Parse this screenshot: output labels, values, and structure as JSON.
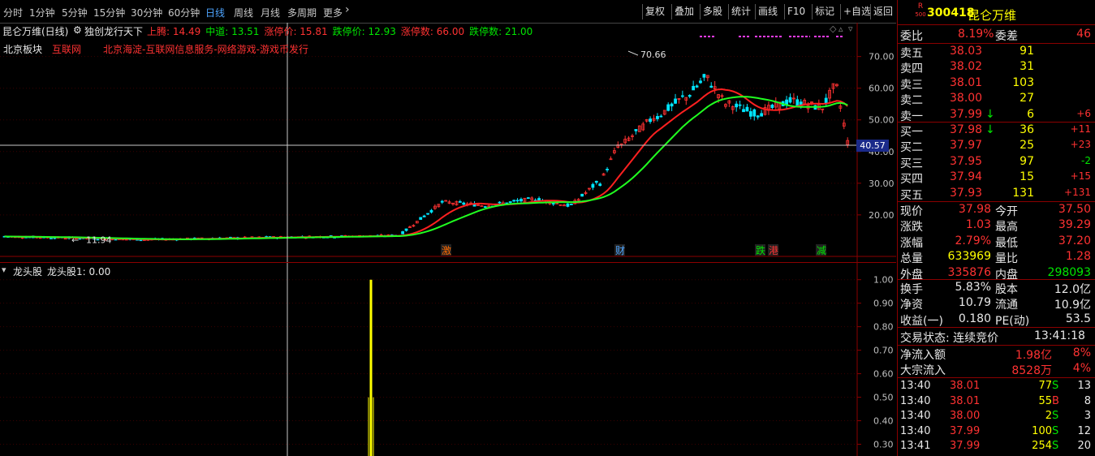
{
  "toolbar": {
    "periods": [
      "分时",
      "1分钟",
      "5分钟",
      "15分钟",
      "30分钟",
      "60分钟",
      "日线",
      "周线",
      "月线",
      "多周期",
      "更多"
    ],
    "active": "日线",
    "more_arrow": "›",
    "right_buttons": [
      "复权",
      "叠加",
      "多股",
      "统计",
      "画线",
      "F10",
      "标记",
      "+自选",
      "返回"
    ]
  },
  "main": {
    "stock_period": "昆仑万维(日线)",
    "indicator_name": "独创龙行天下",
    "lines": [
      {
        "label": "上腾: 14.49",
        "color": "#ff3232"
      },
      {
        "label": "中道: 13.51",
        "color": "#00e600"
      },
      {
        "label": "涨停价: 15.81",
        "color": "#ff3232"
      },
      {
        "label": "跌停价: 12.93",
        "color": "#00e600"
      },
      {
        "label": "涨停数: 66.00",
        "color": "#ff3232"
      },
      {
        "label": "跌停数: 21.00",
        "color": "#00e600"
      }
    ],
    "sector": "北京板块",
    "sector2": "互联网",
    "region_info": "北京海淀-互联网信息服务-网络游戏-游戏币发行",
    "y_ticks": [
      "70.00",
      "60.00",
      "50.00",
      "40.00",
      "30.00",
      "20.00"
    ],
    "crosshair_price": "40.57",
    "high_label": "70.66",
    "low_label": "11.94",
    "events": [
      {
        "text": "激",
        "color": "#ff6a00"
      },
      {
        "text": "财",
        "color": "#4ea5ff"
      },
      {
        "text": "跌",
        "color": "#00e600"
      },
      {
        "text": "港",
        "color": "#ff3232"
      },
      {
        "text": "减",
        "color": "#00e600"
      }
    ]
  },
  "sub": {
    "title": "龙头股",
    "value_label": "龙头股1: 0.00",
    "y_ticks": [
      "1.00",
      "0.90",
      "0.80",
      "0.70",
      "0.60",
      "0.50",
      "0.40",
      "0.30"
    ]
  },
  "quote": {
    "code": "300418",
    "name": "昆仑万维",
    "badge_top": "R",
    "badge_bottom": "500",
    "weibi_label": "委比",
    "weibi": "8.19%",
    "weicha_label": "委差",
    "weicha": "46",
    "sells": [
      {
        "label": "卖五",
        "price": "38.03",
        "vol": "91",
        "chg": ""
      },
      {
        "label": "卖四",
        "price": "38.02",
        "vol": "31",
        "chg": ""
      },
      {
        "label": "卖三",
        "price": "38.01",
        "vol": "103",
        "chg": ""
      },
      {
        "label": "卖二",
        "price": "38.00",
        "vol": "27",
        "chg": ""
      },
      {
        "label": "卖一",
        "price": "37.99",
        "vol": "6",
        "chg": "+6",
        "arrow": "↓"
      }
    ],
    "buys": [
      {
        "label": "买一",
        "price": "37.98",
        "vol": "36",
        "chg": "+11",
        "arrow": "↓"
      },
      {
        "label": "买二",
        "price": "37.97",
        "vol": "25",
        "chg": "+23"
      },
      {
        "label": "买三",
        "price": "37.95",
        "vol": "97",
        "chg": "-2"
      },
      {
        "label": "买四",
        "price": "37.94",
        "vol": "15",
        "chg": "+15"
      },
      {
        "label": "买五",
        "price": "37.93",
        "vol": "131",
        "chg": "+131"
      }
    ],
    "stats": [
      {
        "l1": "现价",
        "v1": "37.98",
        "c1": "red",
        "l2": "今开",
        "v2": "37.50",
        "c2": "red"
      },
      {
        "l1": "涨跌",
        "v1": "1.03",
        "c1": "red",
        "l2": "最高",
        "v2": "39.29",
        "c2": "red"
      },
      {
        "l1": "涨幅",
        "v1": "2.79%",
        "c1": "red",
        "l2": "最低",
        "v2": "37.20",
        "c2": "red"
      },
      {
        "l1": "总量",
        "v1": "633969",
        "c1": "yellow",
        "l2": "量比",
        "v2": "1.28",
        "c2": "red"
      },
      {
        "l1": "外盘",
        "v1": "335876",
        "c1": "red",
        "l2": "内盘",
        "v2": "298093",
        "c2": "green"
      }
    ],
    "stats2": [
      {
        "l1": "换手",
        "v1": "5.83%",
        "l2": "股本",
        "v2": "12.0亿"
      },
      {
        "l1": "净资",
        "v1": "10.79",
        "l2": "流通",
        "v2": "10.9亿"
      },
      {
        "l1": "收益(一)",
        "v1": "0.180",
        "l2": "PE(动)",
        "v2": "53.5"
      }
    ],
    "trade_status": "交易状态: 连续竞价",
    "trade_time": "13:41:18",
    "flows": [
      {
        "label": "净流入额",
        "value": "1.98亿",
        "pct": "8%"
      },
      {
        "label": "大宗流入",
        "value": "8528万",
        "pct": "4%"
      }
    ],
    "ticks": [
      {
        "time": "13:40",
        "price": "38.01",
        "vol": "77",
        "side": "S",
        "n": "13"
      },
      {
        "time": "13:40",
        "price": "38.01",
        "vol": "55",
        "side": "B",
        "n": "8"
      },
      {
        "time": "13:40",
        "price": "38.00",
        "vol": "2",
        "side": "S",
        "n": "3"
      },
      {
        "time": "13:40",
        "price": "37.99",
        "vol": "100",
        "side": "S",
        "n": "12"
      },
      {
        "time": "13:41",
        "price": "37.99",
        "vol": "254",
        "side": "S",
        "n": "20"
      }
    ]
  },
  "colors": {
    "up": "#ff3232",
    "down": "#00e5ff",
    "ma_red": "#ff2020",
    "ma_green": "#20ff20",
    "signal": "#ffff00",
    "grid": "#8b0000"
  }
}
